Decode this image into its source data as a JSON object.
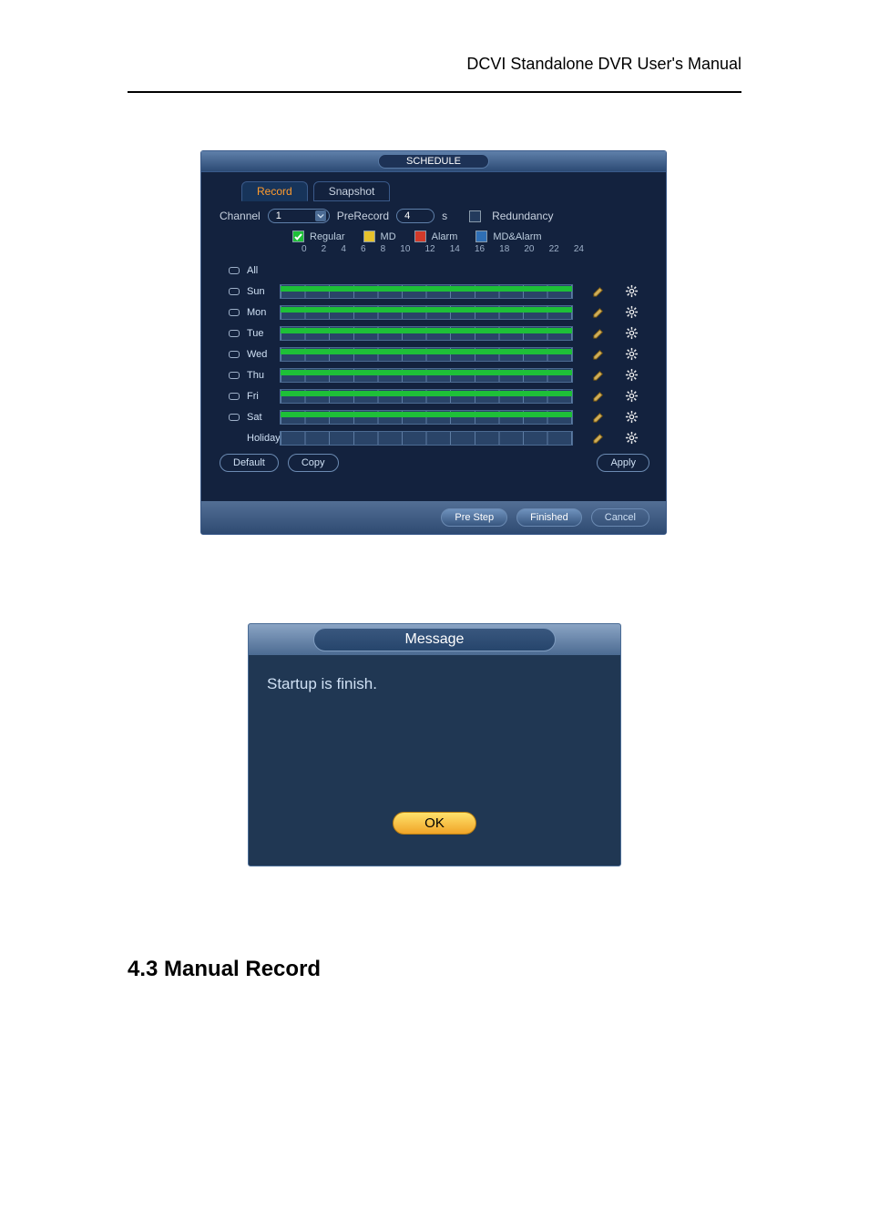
{
  "doc_header": "DCVI Standalone DVR User's Manual",
  "schedule": {
    "window_title": "SCHEDULE",
    "tabs": {
      "record": "Record",
      "snapshot": "Snapshot"
    },
    "channel_label": "Channel",
    "channel_value": "1",
    "prerecord_label": "PreRecord",
    "prerecord_value": "4",
    "prerecord_unit": "s",
    "redundancy_label": "Redundancy",
    "legend": {
      "regular": "Regular",
      "md": "MD",
      "alarm": "Alarm",
      "mdalarm": "MD&Alarm"
    },
    "ticks": [
      "0",
      "2",
      "4",
      "6",
      "8",
      "10",
      "12",
      "14",
      "16",
      "18",
      "20",
      "22",
      "24"
    ],
    "days": [
      "All",
      "Sun",
      "Mon",
      "Tue",
      "Wed",
      "Thu",
      "Fri",
      "Sat",
      "Holiday"
    ],
    "buttons": {
      "default": "Default",
      "copy": "Copy",
      "apply": "Apply",
      "prestep": "Pre Step",
      "finished": "Finished",
      "cancel": "Cancel"
    }
  },
  "message_dialog": {
    "title": "Message",
    "body": "Startup is finish.",
    "ok": "OK"
  },
  "section_heading": "4.3  Manual Record"
}
